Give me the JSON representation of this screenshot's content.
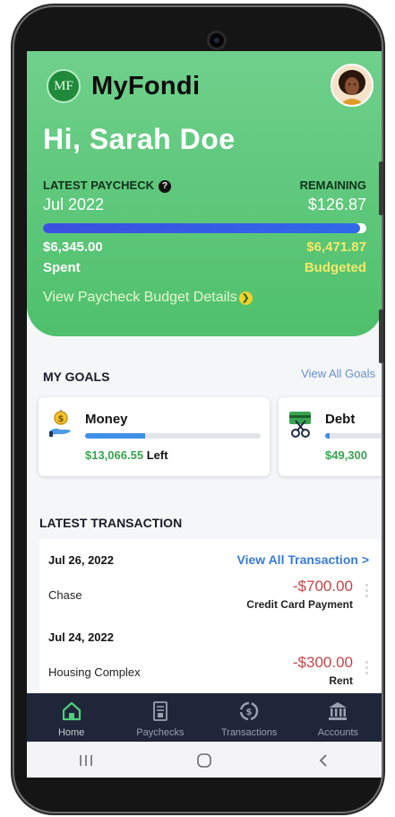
{
  "app": {
    "name": "MyFondi",
    "logo_text": "MF",
    "greeting": "Hi, Sarah Doe"
  },
  "paycheck": {
    "label": "LATEST PAYCHECK",
    "period": "Jul 2022",
    "remaining_label": "REMAINING",
    "remaining_value": "$126.87",
    "spent_value": "$6,345.00",
    "spent_label": "Spent",
    "budgeted_value": "$6,471.87",
    "budgeted_label": "Budgeted",
    "progress_fraction": 0.98,
    "details_link": "View Paycheck Budget Details"
  },
  "goals": {
    "title": "MY GOALS",
    "view_all": "View All Goals",
    "items": [
      {
        "name": "Money",
        "amount": "$13,066.55",
        "suffix": "Left",
        "progress_fraction": 0.34,
        "icon": "money-hand-icon"
      },
      {
        "name": "Debt",
        "amount": "$49,300",
        "suffix": "",
        "progress_fraction": 0.06,
        "icon": "scissors-card-icon"
      }
    ]
  },
  "transactions": {
    "title": "LATEST TRANSACTION",
    "view_all": "View All Transaction >",
    "groups": [
      {
        "date": "Jul 26, 2022",
        "payee": "Chase",
        "amount": "-$700.00",
        "category": "Credit Card Payment"
      },
      {
        "date": "Jul 24, 2022",
        "payee": "Housing Complex",
        "amount": "-$300.00",
        "category": "Rent"
      }
    ]
  },
  "tabs": [
    {
      "label": "Home",
      "icon": "home-icon",
      "active": true
    },
    {
      "label": "Paychecks",
      "icon": "paycheck-icon",
      "active": false
    },
    {
      "label": "Transactions",
      "icon": "transactions-icon",
      "active": false
    },
    {
      "label": "Accounts",
      "icon": "bank-icon",
      "active": false
    }
  ],
  "colors": {
    "hero_green": "#5bc778",
    "tab_bar": "#20263a",
    "progress_blue": "#3b4fe0",
    "negative_amount": "#c74545",
    "link_blue": "#3a7bd5"
  }
}
